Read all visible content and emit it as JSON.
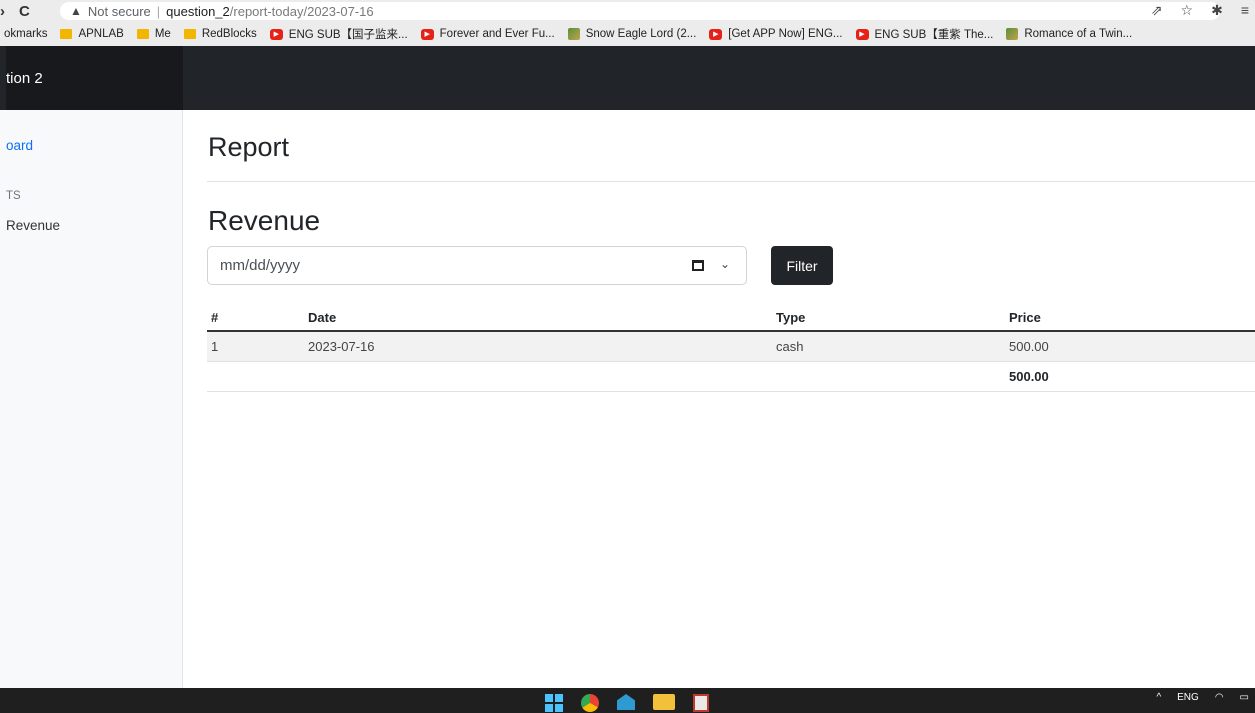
{
  "browser": {
    "not_secure": "Not secure",
    "url_host": "question_2",
    "url_path": "/report-today/2023-07-16",
    "bookmarks": [
      {
        "label": "okmarks",
        "icon": "none"
      },
      {
        "label": "APNLAB",
        "icon": "folder-icon"
      },
      {
        "label": "Me",
        "icon": "folder-icon"
      },
      {
        "label": "RedBlocks",
        "icon": "folder-icon"
      },
      {
        "label": "ENG SUB【国子监来...",
        "icon": "youtube-icon"
      },
      {
        "label": "Forever and Ever Fu...",
        "icon": "youtube-icon"
      },
      {
        "label": "Snow Eagle Lord (2...",
        "icon": "site-icon"
      },
      {
        "label": "[Get APP Now] ENG...",
        "icon": "youtube-icon"
      },
      {
        "label": "ENG SUB【重紫 The...",
        "icon": "youtube-icon"
      },
      {
        "label": "Romance of a Twin...",
        "icon": "site-icon"
      }
    ]
  },
  "app": {
    "brand": "tion 2"
  },
  "sidebar": {
    "link": "oard",
    "heading": "TS",
    "item": "Revenue"
  },
  "main": {
    "page_title": "Report",
    "section_title": "Revenue",
    "date_placeholder": "mm/dd/yyyy",
    "filter_label": "Filter",
    "table": {
      "headers": [
        "#",
        "Date",
        "Type",
        "Price"
      ],
      "rows": [
        {
          "num": "1",
          "date": "2023-07-16",
          "type": "cash",
          "price": "500.00"
        }
      ],
      "total": "500.00"
    }
  },
  "taskbar": {
    "lang": "ENG"
  }
}
